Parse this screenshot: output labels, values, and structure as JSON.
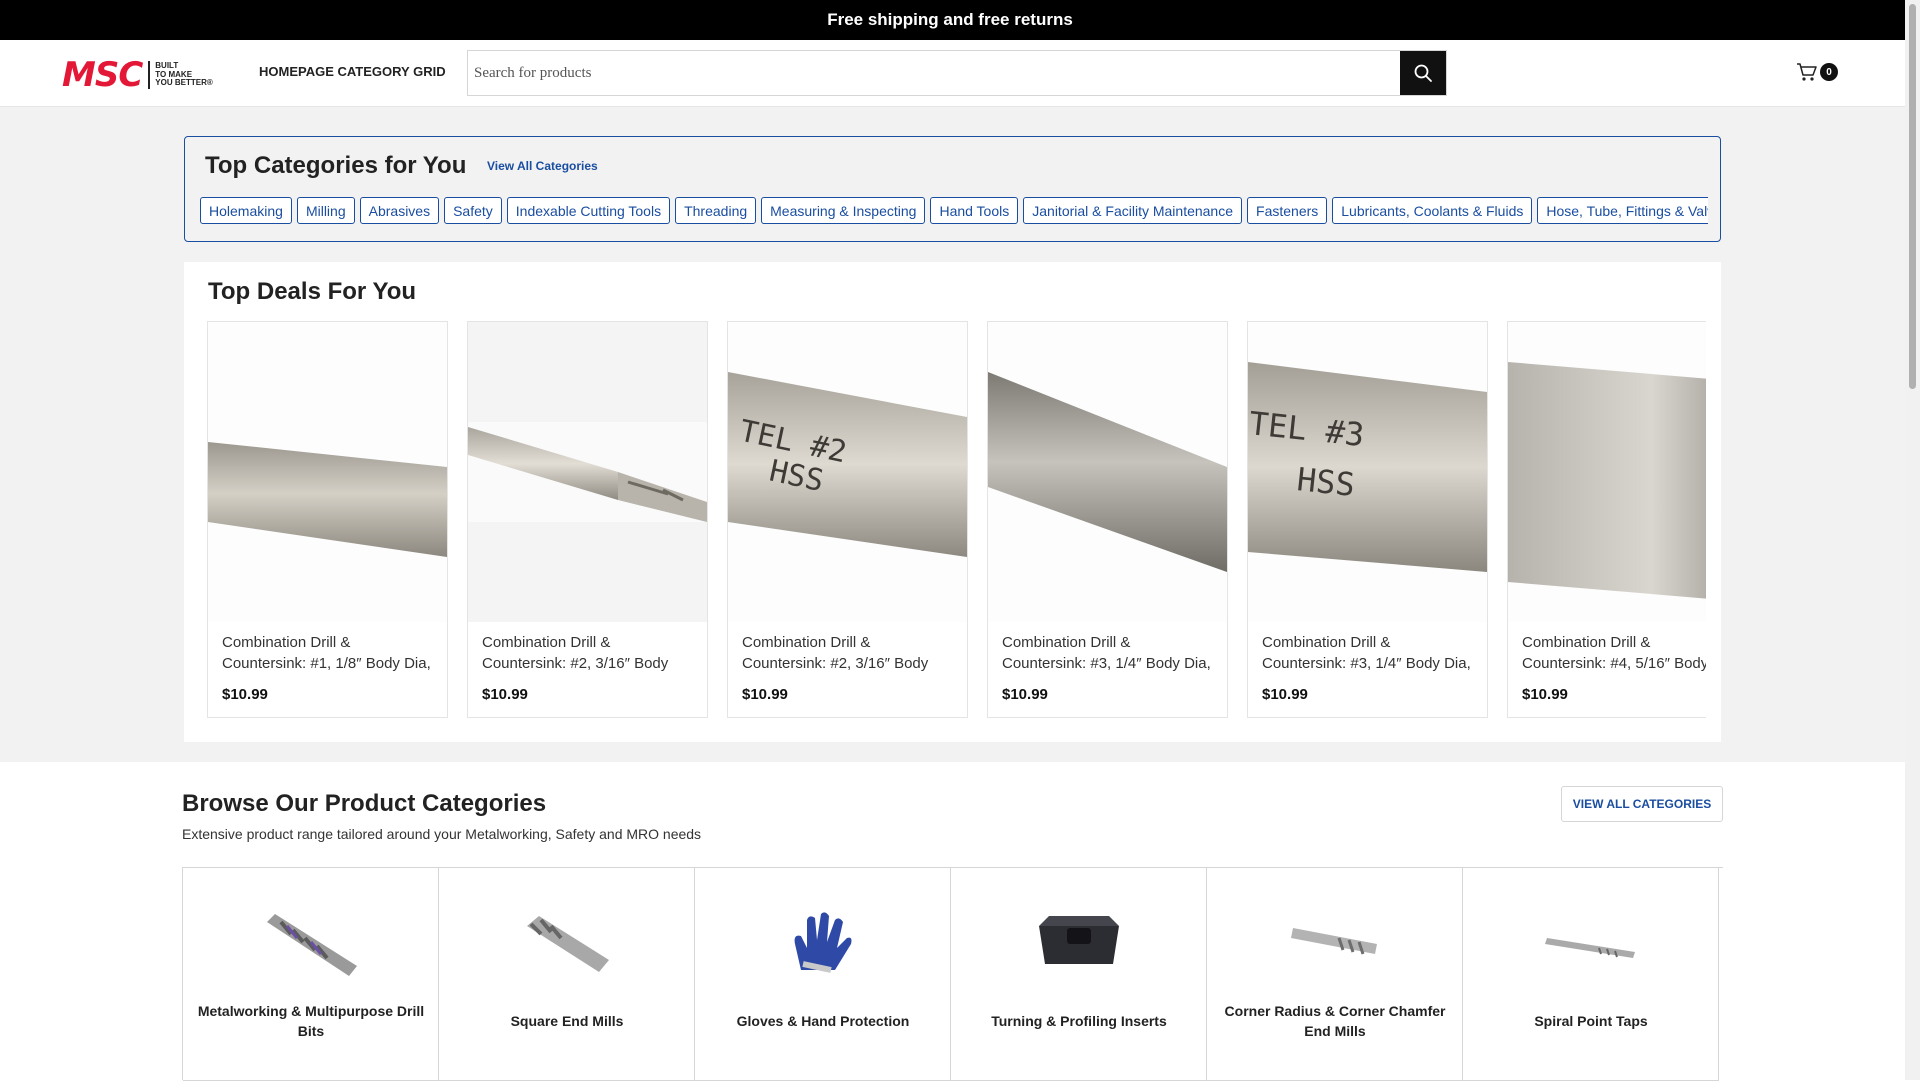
{
  "promo_bar": {
    "text": "Free shipping and free returns"
  },
  "header": {
    "logo_text": "MSC",
    "logo_tagline": [
      "BUILT",
      "TO MAKE",
      "YOU BETTER®"
    ],
    "page_name": "HOMEPAGE CATEGORY GRID",
    "search_placeholder": "Search for products",
    "cart_count": "0"
  },
  "top_categories": {
    "title": "Top Categories for You",
    "view_all": "View All Categories",
    "items": [
      "Holemaking",
      "Milling",
      "Abrasives",
      "Safety",
      "Indexable Cutting Tools",
      "Threading",
      "Measuring & Inspecting",
      "Hand Tools",
      "Janitorial & Facility Maintenance",
      "Fasteners",
      "Lubricants, Coolants & Fluids",
      "Hose, Tube, Fittings & Valves"
    ]
  },
  "deals": {
    "title": "Top Deals For You",
    "products": [
      {
        "name": "Combination Drill & Countersink: #1, 1/8″ Body Dia,",
        "price": "$10.99",
        "image": "drill-shank-plain"
      },
      {
        "name": "Combination Drill & Countersink: #2, 3/16″ Body",
        "price": "$10.99",
        "image": "drill-tip"
      },
      {
        "name": "Combination Drill & Countersink: #2, 3/16″ Body",
        "price": "$10.99",
        "image": "drill-shank-engraved",
        "engraving": [
          "TEL #2",
          "HSS"
        ]
      },
      {
        "name": "Combination Drill & Countersink: #3, 1/4″ Body Dia,",
        "price": "$10.99",
        "image": "drill-shank-dark"
      },
      {
        "name": "Combination Drill & Countersink: #3, 1/4″ Body Dia,",
        "price": "$10.99",
        "image": "drill-shank-engraved",
        "engraving": [
          "TEL #3",
          "HSS"
        ]
      },
      {
        "name": "Combination Drill & Countersink: #4, 5/16″ Body",
        "price": "$10.99",
        "image": "drill-shank-plain"
      }
    ]
  },
  "browse": {
    "title": "Browse Our Product Categories",
    "subtitle": "Extensive product range tailored around your Metalworking, Safety and MRO needs",
    "view_all": "VIEW ALL CATEGORIES",
    "categories": [
      {
        "label": "Metalworking & Multipurpose Drill Bits",
        "icon": "drill-bit-icon"
      },
      {
        "label": "Square End Mills",
        "icon": "end-mill-icon"
      },
      {
        "label": "Gloves & Hand Protection",
        "icon": "glove-icon"
      },
      {
        "label": "Turning & Profiling Inserts",
        "icon": "insert-icon"
      },
      {
        "label": "Corner Radius & Corner Chamfer End Mills",
        "icon": "chamfer-end-mill-icon"
      },
      {
        "label": "Spiral Point Taps",
        "icon": "tap-icon"
      }
    ]
  },
  "colors": {
    "brand_red": "#e31837",
    "link_blue": "#1a4ea1",
    "black": "#000000",
    "band_gray": "#f2f2f2"
  }
}
